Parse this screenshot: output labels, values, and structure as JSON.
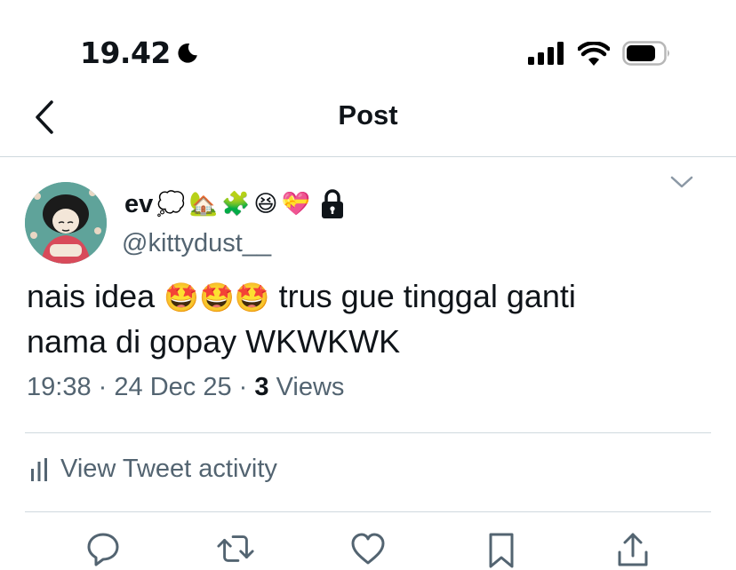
{
  "status_bar": {
    "time": "19.42",
    "icons": [
      "moon-icon",
      "cellular-signal-icon",
      "wifi-icon",
      "battery-icon"
    ]
  },
  "nav": {
    "title": "Post",
    "back_icon": "chevron-left-icon"
  },
  "tweet": {
    "display_name": "ev",
    "name_emojis": [
      "💭",
      "🏡",
      "🧩",
      "😆",
      "💝"
    ],
    "locked_icon": "lock-icon",
    "username": "@kittydust__",
    "text_line1_prefix": "nais idea",
    "text_line1_emojis": "🤩🤩🤩",
    "text_line1_suffix": "trus gue tinggal ganti",
    "text_line2": "nama di gopay WKWKWK",
    "time": "19:38",
    "date": "24 Dec 25",
    "views_count": "3",
    "views_label": "Views",
    "separator": "·"
  },
  "activity": {
    "label": "View Tweet activity",
    "icon": "bar-chart-icon"
  },
  "actions": [
    "reply-icon",
    "retweet-icon",
    "like-icon",
    "bookmark-icon",
    "share-icon"
  ],
  "colors": {
    "text": "#0f1419",
    "secondary": "#536471",
    "divider": "#cfd9de",
    "avatar_bg": "#5fa39a"
  }
}
